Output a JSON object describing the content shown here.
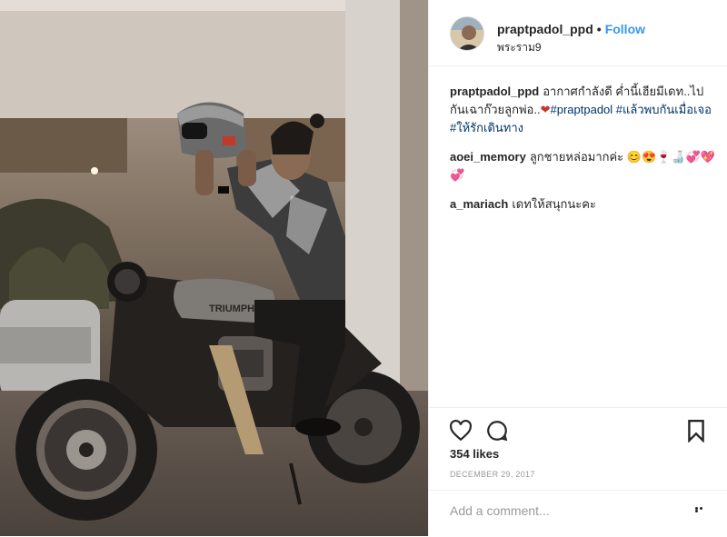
{
  "post": {
    "username": "praptpadol_ppd",
    "separator": "•",
    "follow_label": "Follow",
    "location": "พระราม9",
    "caption": {
      "username": "praptpadol_ppd",
      "text": "อากาศกำลังดี ค่ำนี้เฮียมีเดท..ไปกันเฉาก๊วยลูกพ่อ..",
      "heart": "❤",
      "hashtags": [
        "#praptpadol",
        "#แล้วพบกันเมื่อเจอ",
        "#ให้รักเดินทาง"
      ]
    },
    "comments": [
      {
        "username": "aoei_memory",
        "text": "ลูกชายหล่อมากค่ะ 😊😍🍷🍶💞💖💞"
      },
      {
        "username": "a_mariach",
        "text": "เดทให้สนุกนะคะ"
      }
    ],
    "likes_label": "354 likes",
    "date": "DECEMBER 29, 2017",
    "add_comment_placeholder": "Add a comment...",
    "photo_brand": "TRIUMPH"
  },
  "icons": {
    "like": "heart-outline-icon",
    "comment": "speech-bubble-icon",
    "save": "bookmark-icon",
    "more": "more-options-icon"
  },
  "colors": {
    "follow": "#3897f0",
    "hashtag": "#003569",
    "muted": "#999999",
    "border": "#efefef"
  }
}
